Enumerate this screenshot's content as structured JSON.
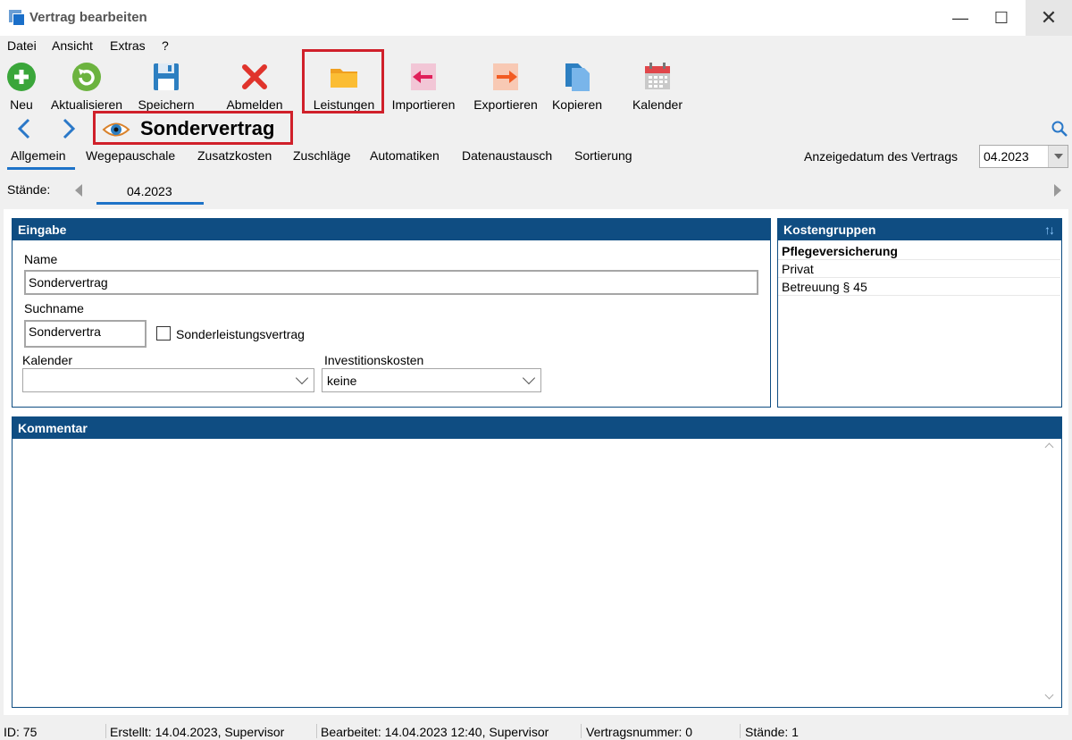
{
  "window": {
    "title": "Vertrag bearbeiten",
    "minimize": "—",
    "maximize": "☐",
    "close": "✕"
  },
  "menu": [
    "Datei",
    "Ansicht",
    "Extras",
    "?"
  ],
  "toolbar": {
    "neu": "Neu",
    "aktualisieren": "Aktualisieren",
    "speichern": "Speichern",
    "abmelden": "Abmelden",
    "leistungen": "Leistungen",
    "importieren": "Importieren",
    "exportieren": "Exportieren",
    "kopieren": "Kopieren",
    "kalender": "Kalender"
  },
  "contract": {
    "title": "Sondervertrag",
    "icon": "eye-icon"
  },
  "tabs": [
    "Allgemein",
    "Wegepauschale",
    "Zusatzkosten",
    "Zuschläge",
    "Automatiken",
    "Datenaustausch",
    "Sortierung"
  ],
  "anzeigedatum": {
    "label": "Anzeigedatum des Vertrags",
    "value": "04.2023"
  },
  "staende": {
    "label": "Stände:",
    "items": [
      "04.2023"
    ]
  },
  "eingabe": {
    "header": "Eingabe",
    "name_label": "Name",
    "name_value": "Sondervertrag",
    "suchname_label": "Suchname",
    "suchname_value": "Sondervertra",
    "sonderleistung_label": "Sonderleistungsvertrag",
    "kalender_label": "Kalender",
    "kalender_value": "",
    "investition_label": "Investitionskosten",
    "investition_value": "keine"
  },
  "kostengruppen": {
    "header": "Kostengruppen",
    "items": [
      "Pflegeversicherung",
      "Privat",
      "Betreuung § 45"
    ]
  },
  "kommentar": {
    "header": "Kommentar"
  },
  "status": {
    "id": "ID: 75",
    "erstellt": "Erstellt: 14.04.2023, Supervisor",
    "bearbeitet": "Bearbeitet: 14.04.2023 12:40, Supervisor",
    "vertragsnummer": "Vertragsnummer: 0",
    "staende": "Stände: 1"
  },
  "colors": {
    "header_blue": "#0f4d82",
    "highlight_red": "#d0202a",
    "tab_underline": "#1e73c8"
  }
}
